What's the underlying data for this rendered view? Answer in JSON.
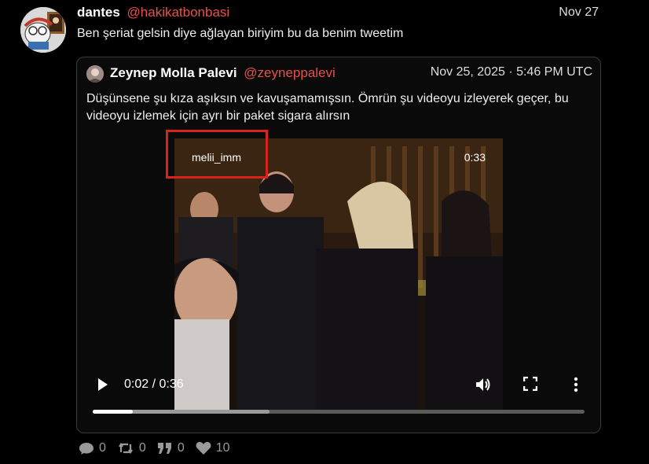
{
  "tweet": {
    "author_name": "dantes",
    "author_handle": "@hakikatbonbasi",
    "date": "Nov 27",
    "text": "Ben şeriat gelsin diye ağlayan biriyim bu da benim tweetim"
  },
  "quoted": {
    "author_name": "Zeynep Molla Palevi",
    "author_handle": "@zeyneppalevi",
    "date": "Nov 25, 2025 · 5:46 PM UTC",
    "text": "Düşünsene şu kıza aşıksın ve kavuşamamışsın. Ömrün şu videoyu izleyerek geçer, bu videoyu izlemek için ayrı bir paket sigara alırsın"
  },
  "video": {
    "watermark": "melii_imm",
    "overlay_duration": "0:33",
    "time_display": "0:02 / 0:36",
    "played_fraction": 0.082,
    "buffered_fraction": 0.36
  },
  "stats": {
    "replies": "0",
    "retweets": "0",
    "quotes": "0",
    "likes": "10"
  },
  "colors": {
    "handle": "#e8514a",
    "highlight_box": "#d8221c"
  },
  "icons": [
    "avatar-cartoon",
    "play-icon",
    "volume-icon",
    "fullscreen-icon",
    "more-vertical-icon",
    "comment-icon",
    "retweet-icon",
    "quote-icon",
    "heart-icon"
  ]
}
